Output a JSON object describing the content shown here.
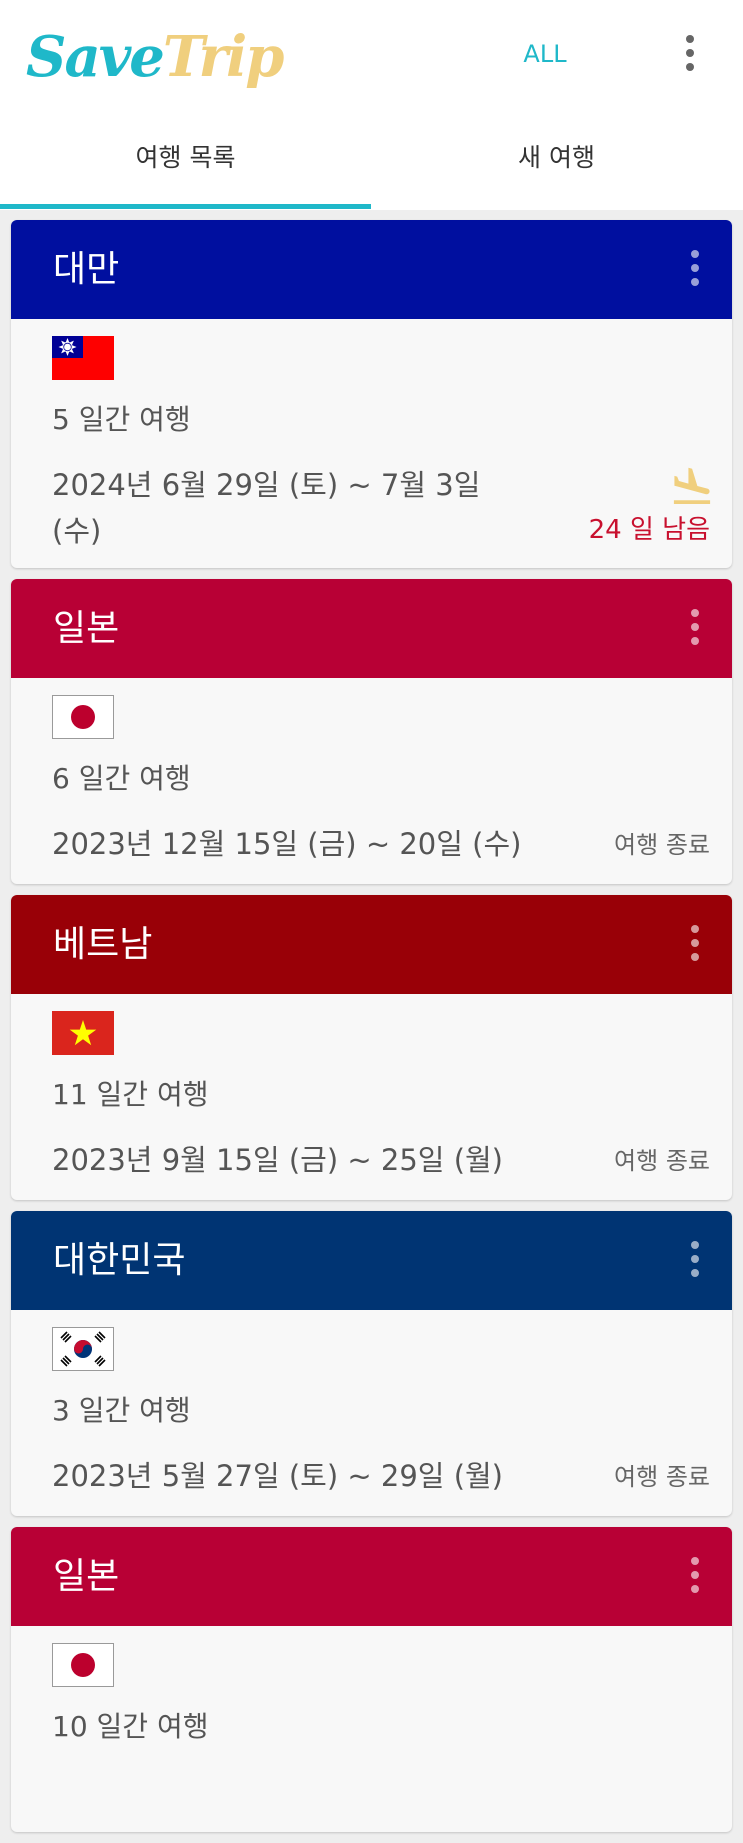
{
  "app": {
    "logo_part1": "Save",
    "logo_part2": "Trip",
    "filter_label": "ALL",
    "overflow_icon": "more-vert-icon"
  },
  "tabs": [
    {
      "label": "여행 목록",
      "selected": true
    },
    {
      "label": "새 여행",
      "selected": false
    }
  ],
  "colors": {
    "accent": "#1fb8c9",
    "logo_secondary": "#f0cf7e",
    "countdown": "#c8102e",
    "header_taiwan": "#000f9f",
    "header_japan": "#b80035",
    "header_vietnam": "#990007",
    "header_korea": "#003473"
  },
  "trips": [
    {
      "country": "대만",
      "flag": "taiwan-flag",
      "duration": "5 일간 여행",
      "dates_line1": "2024년 6월 29일 (토) ~ 7월 3일",
      "dates_line2": "(수)",
      "status_icon": "flight-land-icon",
      "countdown": "24 일 남음"
    },
    {
      "country": "일본",
      "flag": "japan-flag",
      "duration": "6 일간 여행",
      "dates": "2023년 12월 15일 (금) ~ 20일 (수)",
      "status": "여행 종료"
    },
    {
      "country": "베트남",
      "flag": "vietnam-flag",
      "duration": "11 일간 여행",
      "dates": "2023년 9월 15일 (금) ~ 25일 (월)",
      "status": "여행 종료"
    },
    {
      "country": "대한민국",
      "flag": "korea-flag",
      "duration": "3 일간 여행",
      "dates": "2023년 5월 27일 (토) ~ 29일 (월)",
      "status": "여행 종료"
    },
    {
      "country": "일본",
      "flag": "japan-flag",
      "duration": "10 일간 여행"
    }
  ]
}
